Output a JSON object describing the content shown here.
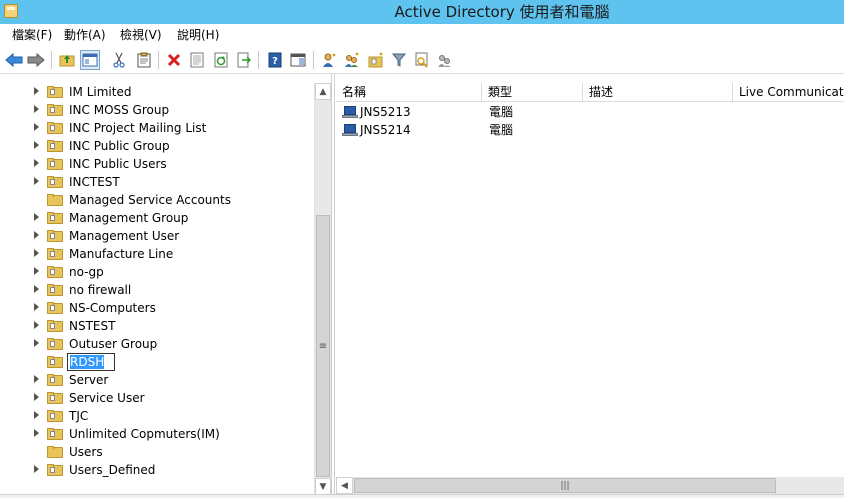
{
  "window": {
    "title": "Active Directory 使用者和電腦"
  },
  "menu": [
    {
      "label": "檔案(F)"
    },
    {
      "label": "動作(A)"
    },
    {
      "label": "檢視(V)"
    },
    {
      "label": "說明(H)"
    }
  ],
  "toolbar": {
    "buttons": [
      {
        "icon": "back-arrow-icon"
      },
      {
        "icon": "forward-arrow-icon"
      },
      {
        "icon": "up-folder-icon"
      },
      {
        "icon": "show-hide-console-tree-icon"
      },
      {
        "icon": "cut-icon"
      },
      {
        "icon": "copy-icon"
      },
      {
        "icon": "delete-icon"
      },
      {
        "icon": "properties-icon"
      },
      {
        "icon": "refresh-icon"
      },
      {
        "icon": "export-list-icon"
      },
      {
        "icon": "help-icon"
      },
      {
        "icon": "show-action-pane-icon"
      },
      {
        "icon": "new-user-icon"
      },
      {
        "icon": "new-group-icon"
      },
      {
        "icon": "new-ou-icon"
      },
      {
        "icon": "filter-icon"
      },
      {
        "icon": "find-icon"
      },
      {
        "icon": "add-to-group-icon"
      }
    ]
  },
  "tree": {
    "items": [
      {
        "label": "IM Limited",
        "expandable": true
      },
      {
        "label": "INC MOSS Group",
        "expandable": true
      },
      {
        "label": "INC Project Mailing List",
        "expandable": true
      },
      {
        "label": "INC Public Group",
        "expandable": true
      },
      {
        "label": "INC Public Users",
        "expandable": true
      },
      {
        "label": "INCTEST",
        "expandable": true
      },
      {
        "label": "Managed Service Accounts",
        "expandable": false
      },
      {
        "label": "Management Group",
        "expandable": true
      },
      {
        "label": "Management User",
        "expandable": true
      },
      {
        "label": "Manufacture Line",
        "expandable": true
      },
      {
        "label": "no-gp",
        "expandable": true
      },
      {
        "label": "no firewall",
        "expandable": true
      },
      {
        "label": "NS-Computers",
        "expandable": true
      },
      {
        "label": "NSTEST",
        "expandable": true
      },
      {
        "label": "Outuser Group",
        "expandable": true
      },
      {
        "label": "RDSH",
        "expandable": false,
        "editing": true
      },
      {
        "label": "Server",
        "expandable": true
      },
      {
        "label": "Service User",
        "expandable": true
      },
      {
        "label": "TJC",
        "expandable": true
      },
      {
        "label": "Unlimited Copmuters(IM)",
        "expandable": true
      },
      {
        "label": "Users",
        "expandable": false
      },
      {
        "label": "Users_Defined",
        "expandable": true
      }
    ]
  },
  "list": {
    "columns": [
      {
        "label": "名稱"
      },
      {
        "label": "類型"
      },
      {
        "label": "描述"
      },
      {
        "label": "Live Communications"
      }
    ],
    "rows": [
      {
        "name": "JNS5213",
        "type": "電腦",
        "description": "",
        "live": ""
      },
      {
        "name": "JNS5214",
        "type": "電腦",
        "description": "",
        "live": ""
      }
    ]
  }
}
